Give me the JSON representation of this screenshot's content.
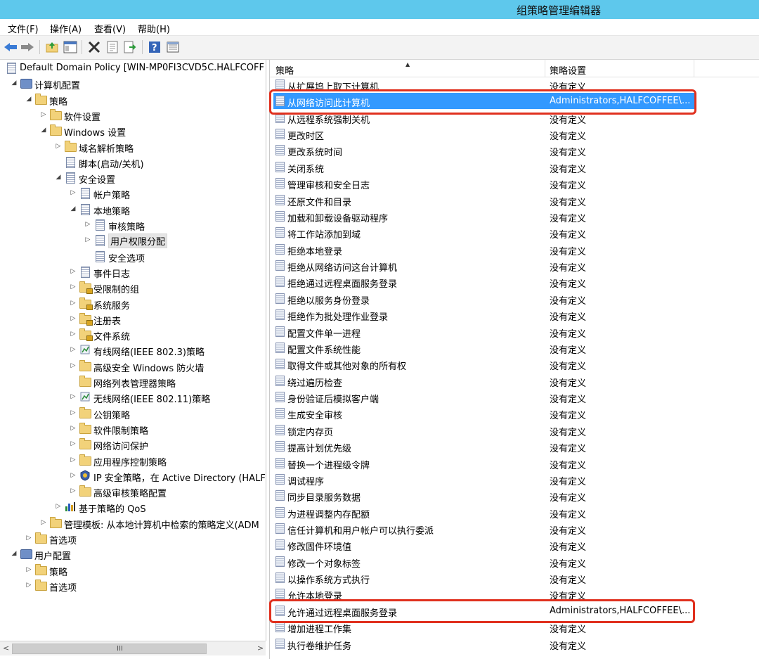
{
  "window": {
    "title": "组策略管理编辑器"
  },
  "menu": [
    "文件(F)",
    "操作(A)",
    "查看(V)",
    "帮助(H)"
  ],
  "toolbar": {
    "buttons": [
      "back-arrow-icon",
      "forward-arrow-icon",
      "up-folder-icon",
      "show-hide-tree-icon",
      "delete-x-icon",
      "properties-icon",
      "export-list-icon",
      "help-icon",
      "details-view-icon"
    ]
  },
  "tree": [
    {
      "label": "Default Domain Policy [WIN-MP0FI3CVD5C.HALFCOFF",
      "icon": "policy-document-icon",
      "arrow": "",
      "depth": 0
    },
    {
      "label": "计算机配置",
      "icon": "computer-icon",
      "arrow": "◢",
      "depth": 1
    },
    {
      "label": "策略",
      "icon": "folder-icon",
      "arrow": "◢",
      "depth": 2
    },
    {
      "label": "软件设置",
      "icon": "folder-icon",
      "arrow": "▷",
      "depth": 3
    },
    {
      "label": "Windows 设置",
      "icon": "folder-icon",
      "arrow": "◢",
      "depth": 3
    },
    {
      "label": "域名解析策略",
      "icon": "folder-icon",
      "arrow": "▷",
      "depth": 4
    },
    {
      "label": "脚本(启动/关机)",
      "icon": "script-icon",
      "arrow": "",
      "depth": 4
    },
    {
      "label": "安全设置",
      "icon": "security-settings-icon",
      "arrow": "◢",
      "depth": 4
    },
    {
      "label": "帐户策略",
      "icon": "policy-folder-icon",
      "arrow": "▷",
      "depth": 5
    },
    {
      "label": "本地策略",
      "icon": "policy-folder-icon",
      "arrow": "◢",
      "depth": 5
    },
    {
      "label": "审核策略",
      "icon": "policy-folder-icon",
      "arrow": "▷",
      "depth": 6
    },
    {
      "label": "用户权限分配",
      "icon": "policy-folder-icon",
      "arrow": "▷",
      "depth": 6,
      "selected": true
    },
    {
      "label": "安全选项",
      "icon": "policy-folder-icon",
      "arrow": "",
      "depth": 6
    },
    {
      "label": "事件日志",
      "icon": "policy-folder-icon",
      "arrow": "▷",
      "depth": 5
    },
    {
      "label": "受限制的组",
      "icon": "lock-folder-icon",
      "arrow": "▷",
      "depth": 5
    },
    {
      "label": "系统服务",
      "icon": "lock-folder-icon",
      "arrow": "▷",
      "depth": 5
    },
    {
      "label": "注册表",
      "icon": "lock-folder-icon",
      "arrow": "▷",
      "depth": 5
    },
    {
      "label": "文件系统",
      "icon": "lock-folder-icon",
      "arrow": "▷",
      "depth": 5
    },
    {
      "label": "有线网络(IEEE 802.3)策略",
      "icon": "wired-network-icon",
      "arrow": "▷",
      "depth": 5
    },
    {
      "label": "高级安全 Windows 防火墙",
      "icon": "folder-icon",
      "arrow": "▷",
      "depth": 5
    },
    {
      "label": "网络列表管理器策略",
      "icon": "folder-icon",
      "arrow": "",
      "depth": 5
    },
    {
      "label": "无线网络(IEEE 802.11)策略",
      "icon": "wireless-network-icon",
      "arrow": "▷",
      "depth": 5
    },
    {
      "label": "公钥策略",
      "icon": "folder-icon",
      "arrow": "▷",
      "depth": 5
    },
    {
      "label": "软件限制策略",
      "icon": "folder-icon",
      "arrow": "▷",
      "depth": 5
    },
    {
      "label": "网络访问保护",
      "icon": "folder-icon",
      "arrow": "▷",
      "depth": 5
    },
    {
      "label": "应用程序控制策略",
      "icon": "folder-icon",
      "arrow": "▷",
      "depth": 5
    },
    {
      "label": "IP 安全策略，在 Active Directory (HALF",
      "icon": "ip-security-icon",
      "arrow": "▷",
      "depth": 5
    },
    {
      "label": "高级审核策略配置",
      "icon": "folder-icon",
      "arrow": "▷",
      "depth": 5
    },
    {
      "label": "基于策略的 QoS",
      "icon": "qos-chart-icon",
      "arrow": "▷",
      "depth": 4
    },
    {
      "label": "管理模板: 从本地计算机中检索的策略定义(ADM",
      "icon": "folder-icon",
      "arrow": "▷",
      "depth": 3
    },
    {
      "label": "首选项",
      "icon": "folder-icon",
      "arrow": "▷",
      "depth": 2
    },
    {
      "label": "用户配置",
      "icon": "users-icon",
      "arrow": "◢",
      "depth": 1
    },
    {
      "label": "策略",
      "icon": "folder-icon",
      "arrow": "▷",
      "depth": 2
    },
    {
      "label": "首选项",
      "icon": "folder-icon",
      "arrow": "▷",
      "depth": 2
    }
  ],
  "list": {
    "columns": [
      "策略",
      "策略设置"
    ],
    "rows": [
      {
        "name": "从扩展坞上取下计算机",
        "value": "没有定义"
      },
      {
        "name": "从网络访问此计算机",
        "value": "Administrators,HALFCOFFEE\\...",
        "selected": true
      },
      {
        "name": "从远程系统强制关机",
        "value": "没有定义"
      },
      {
        "name": "更改时区",
        "value": "没有定义"
      },
      {
        "name": "更改系统时间",
        "value": "没有定义"
      },
      {
        "name": "关闭系统",
        "value": "没有定义"
      },
      {
        "name": "管理审核和安全日志",
        "value": "没有定义"
      },
      {
        "name": "还原文件和目录",
        "value": "没有定义"
      },
      {
        "name": "加载和卸载设备驱动程序",
        "value": "没有定义"
      },
      {
        "name": "将工作站添加到域",
        "value": "没有定义"
      },
      {
        "name": "拒绝本地登录",
        "value": "没有定义"
      },
      {
        "name": "拒绝从网络访问这台计算机",
        "value": "没有定义"
      },
      {
        "name": "拒绝通过远程桌面服务登录",
        "value": "没有定义"
      },
      {
        "name": "拒绝以服务身份登录",
        "value": "没有定义"
      },
      {
        "name": "拒绝作为批处理作业登录",
        "value": "没有定义"
      },
      {
        "name": "配置文件单一进程",
        "value": "没有定义"
      },
      {
        "name": "配置文件系统性能",
        "value": "没有定义"
      },
      {
        "name": "取得文件或其他对象的所有权",
        "value": "没有定义"
      },
      {
        "name": "绕过遍历检查",
        "value": "没有定义"
      },
      {
        "name": "身份验证后模拟客户端",
        "value": "没有定义"
      },
      {
        "name": "生成安全审核",
        "value": "没有定义"
      },
      {
        "name": "锁定内存页",
        "value": "没有定义"
      },
      {
        "name": "提高计划优先级",
        "value": "没有定义"
      },
      {
        "name": "替换一个进程级令牌",
        "value": "没有定义"
      },
      {
        "name": "调试程序",
        "value": "没有定义"
      },
      {
        "name": "同步目录服务数据",
        "value": "没有定义"
      },
      {
        "name": "为进程调整内存配额",
        "value": "没有定义"
      },
      {
        "name": "信任计算机和用户帐户可以执行委派",
        "value": "没有定义"
      },
      {
        "name": "修改固件环境值",
        "value": "没有定义"
      },
      {
        "name": "修改一个对象标签",
        "value": "没有定义"
      },
      {
        "name": "以操作系统方式执行",
        "value": "没有定义"
      },
      {
        "name": "允许本地登录",
        "value": "没有定义"
      },
      {
        "name": "允许通过远程桌面服务登录",
        "value": "Administrators,HALFCOFFEE\\..."
      },
      {
        "name": "增加进程工作集",
        "value": "没有定义"
      },
      {
        "name": "执行卷维护任务",
        "value": "没有定义"
      }
    ]
  },
  "scrollbar": {
    "grip": "III",
    "left_arrow": "<",
    "right_arrow": ">"
  },
  "colors": {
    "titlebar": "#5ec8ec",
    "selection": "#3399ff",
    "highlight_box": "#e0301e"
  }
}
